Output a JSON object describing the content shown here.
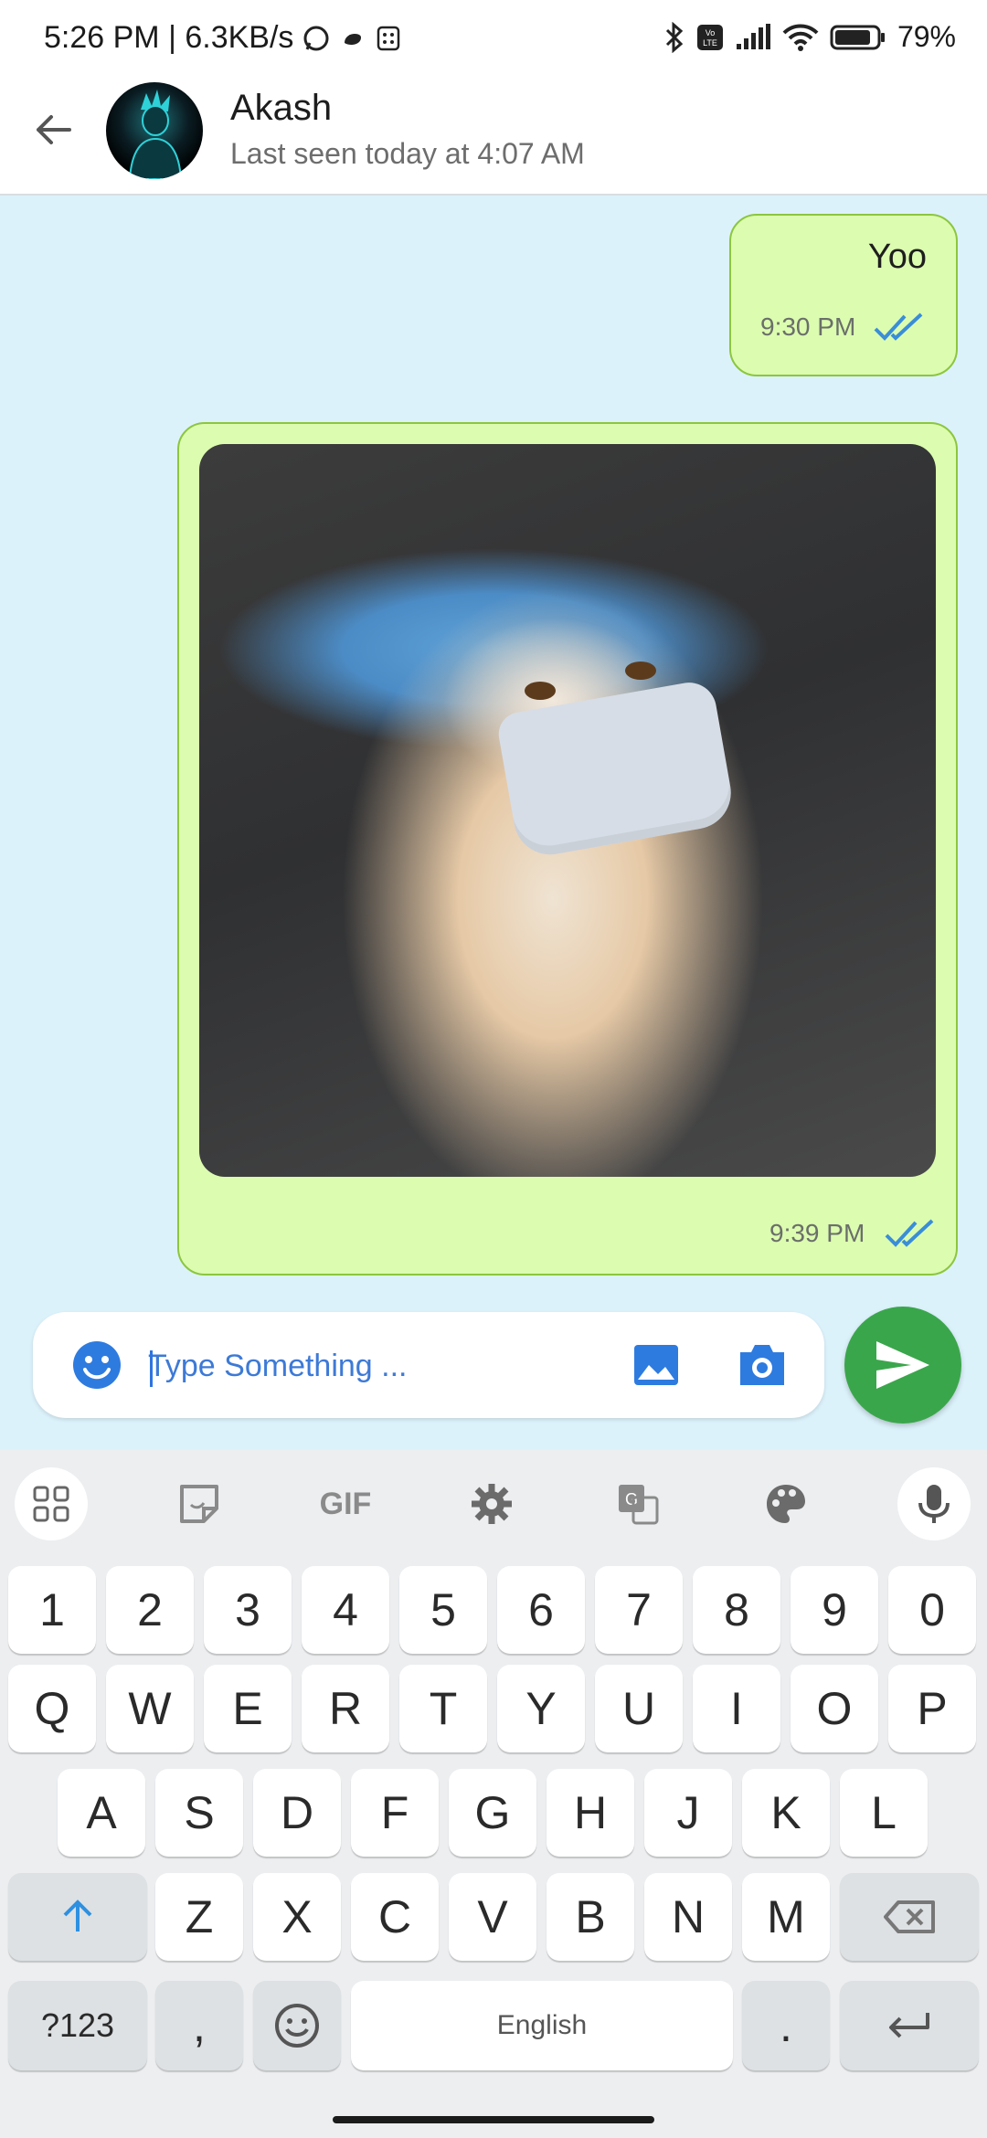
{
  "status_bar": {
    "time_speed": "5:26 PM | 6.3KB/s",
    "battery": "79%",
    "volte_label": "Vo LTE"
  },
  "header": {
    "contact_name": "Akash",
    "last_seen": "Last seen today at 4:07 AM"
  },
  "messages": [
    {
      "type": "text",
      "text": "Yoo",
      "time": "9:30 PM",
      "status": "read"
    },
    {
      "type": "image",
      "image": "kitten-wearing-mask-and-cap-photo",
      "time": "9:39 PM",
      "status": "read"
    }
  ],
  "composer": {
    "placeholder": "Type Something ..."
  },
  "keyboard": {
    "toolbar": [
      "apps-grid-icon",
      "sticker-icon",
      "GIF",
      "settings-icon",
      "translate-icon",
      "palette-icon",
      "microphone-icon"
    ],
    "gif_label": "GIF",
    "number_row": [
      "1",
      "2",
      "3",
      "4",
      "5",
      "6",
      "7",
      "8",
      "9",
      "0"
    ],
    "row1": [
      "Q",
      "W",
      "E",
      "R",
      "T",
      "Y",
      "U",
      "I",
      "O",
      "P"
    ],
    "row2": [
      "A",
      "S",
      "D",
      "F",
      "G",
      "H",
      "J",
      "K",
      "L"
    ],
    "row3": [
      "Z",
      "X",
      "C",
      "V",
      "B",
      "N",
      "M"
    ],
    "symbols_label": "?123",
    "comma": ",",
    "space_label": "English",
    "period": "."
  },
  "colors": {
    "chat_background": "#dcf2fb",
    "bubble_fill": "#dcfcb0",
    "bubble_border": "#8cc63f",
    "send_button": "#3aa64b",
    "read_ticks": "#3a8ed8",
    "accent_blue": "#3d7ad6"
  }
}
